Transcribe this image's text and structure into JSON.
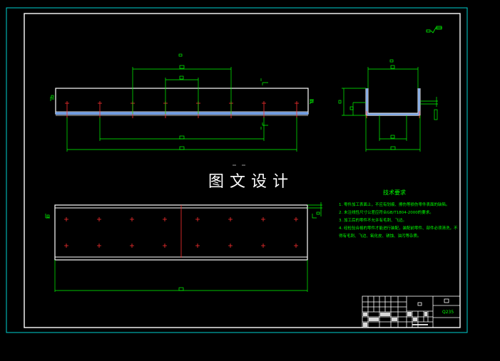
{
  "drawing": {
    "title": "图文设计",
    "technical_requirements": {
      "heading": "技术要求",
      "lines": [
        "1. 零件加工表面上，不应有划痕、擦伤等损伤零件表面的缺陷。",
        "2. 未注线性尺寸公差应符合GB/T1804-2000的要求。",
        "3. 加工后的零件不允许有毛刺、飞边。",
        "4. 经检验合格的零件才能进行装配，装配前零件、部件必须清洗，不",
        "得有毛刺、飞边、氧化皮、锈蚀、油污等杂质。"
      ]
    },
    "title_block": {
      "material": "Q235"
    },
    "colors": {
      "frame": "#ffffff",
      "outer_frame": "#00d0d0",
      "dimension": "#00ff00",
      "hole_marker": "#ff3030",
      "hatch": "#6fa8ff"
    }
  }
}
